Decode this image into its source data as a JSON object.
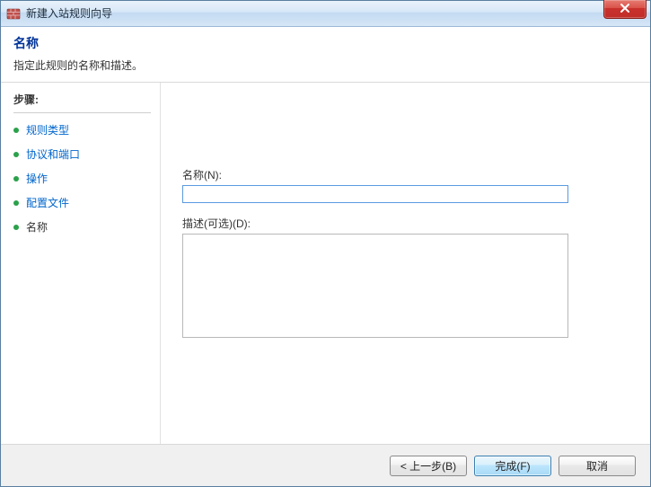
{
  "window": {
    "title": "新建入站规则向导"
  },
  "header": {
    "title": "名称",
    "subtitle": "指定此规则的名称和描述。"
  },
  "sidebar": {
    "steps_label": "步骤:",
    "items": [
      {
        "label": "规则类型",
        "current": false
      },
      {
        "label": "协议和端口",
        "current": false
      },
      {
        "label": "操作",
        "current": false
      },
      {
        "label": "配置文件",
        "current": false
      },
      {
        "label": "名称",
        "current": true
      }
    ]
  },
  "form": {
    "name_label": "名称(N):",
    "name_value": "",
    "desc_label": "描述(可选)(D):",
    "desc_value": ""
  },
  "footer": {
    "back": "< 上一步(B)",
    "finish": "完成(F)",
    "cancel": "取消"
  }
}
